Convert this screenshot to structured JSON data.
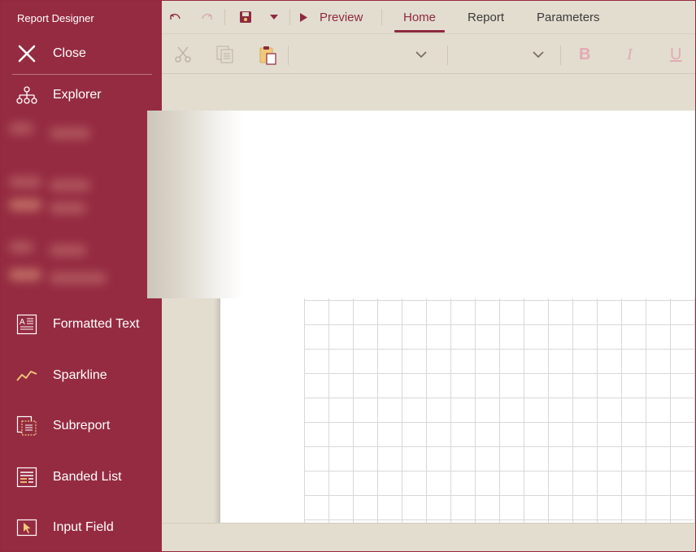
{
  "app": {
    "title": "Report Designer"
  },
  "sidebar": {
    "close_label": "Close",
    "explorer_label": "Explorer",
    "items": [
      {
        "label": "Formatted Text",
        "icon": "formatted-text-icon"
      },
      {
        "label": "Sparkline",
        "icon": "sparkline-icon"
      },
      {
        "label": "Subreport",
        "icon": "subreport-icon"
      },
      {
        "label": "Banded List",
        "icon": "banded-list-icon"
      },
      {
        "label": "Input Field",
        "icon": "input-field-icon"
      }
    ]
  },
  "toolbar": {
    "preview_label": "Preview",
    "tabs": [
      {
        "label": "Home",
        "active": true
      },
      {
        "label": "Report",
        "active": false
      },
      {
        "label": "Parameters",
        "active": false
      }
    ],
    "font_family_value": "",
    "font_size_value": "",
    "bold_label": "B",
    "italic_label": "I",
    "underline_label": "U"
  },
  "colors": {
    "accent": "#952b41",
    "toolbar_bg": "#e2ddcf",
    "disabled_format": "#e3a9b4"
  }
}
